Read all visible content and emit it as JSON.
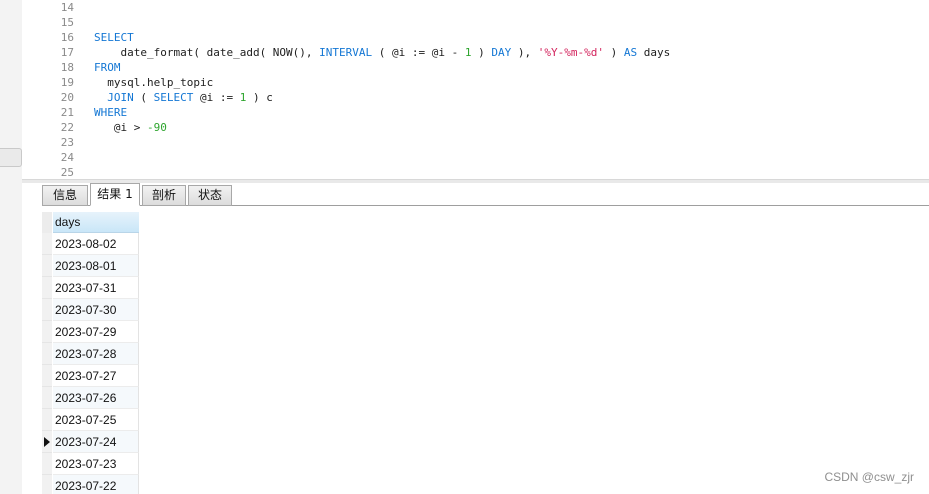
{
  "editor": {
    "lines": [
      {
        "num": "14",
        "tokens": []
      },
      {
        "num": "15",
        "tokens": []
      },
      {
        "num": "16",
        "tokens": [
          {
            "t": "SELECT",
            "c": "kw"
          }
        ]
      },
      {
        "num": "17",
        "tokens": [
          {
            "t": "    date_format( date_add( NOW(), ",
            "c": ""
          },
          {
            "t": "INTERVAL",
            "c": "kw"
          },
          {
            "t": " ( @i := @i - ",
            "c": ""
          },
          {
            "t": "1",
            "c": "num"
          },
          {
            "t": " ) ",
            "c": ""
          },
          {
            "t": "DAY",
            "c": "kw"
          },
          {
            "t": " ), ",
            "c": ""
          },
          {
            "t": "'%Y-%m-%d'",
            "c": "str"
          },
          {
            "t": " ) ",
            "c": ""
          },
          {
            "t": "AS",
            "c": "kw"
          },
          {
            "t": " days",
            "c": ""
          }
        ]
      },
      {
        "num": "18",
        "tokens": [
          {
            "t": "FROM",
            "c": "kw"
          }
        ]
      },
      {
        "num": "19",
        "tokens": [
          {
            "t": "  mysql.help_topic",
            "c": ""
          }
        ]
      },
      {
        "num": "20",
        "tokens": [
          {
            "t": "  ",
            "c": ""
          },
          {
            "t": "JOIN",
            "c": "kw"
          },
          {
            "t": " ( ",
            "c": ""
          },
          {
            "t": "SELECT",
            "c": "kw"
          },
          {
            "t": " @i := ",
            "c": ""
          },
          {
            "t": "1",
            "c": "num"
          },
          {
            "t": " ) c",
            "c": ""
          }
        ]
      },
      {
        "num": "21",
        "tokens": [
          {
            "t": "WHERE",
            "c": "kw"
          }
        ]
      },
      {
        "num": "22",
        "tokens": [
          {
            "t": "   @i > ",
            "c": ""
          },
          {
            "t": "-90",
            "c": "num"
          }
        ]
      },
      {
        "num": "23",
        "tokens": []
      },
      {
        "num": "24",
        "tokens": []
      },
      {
        "num": "25",
        "tokens": []
      }
    ]
  },
  "tabs": [
    {
      "label": "信息",
      "active": false
    },
    {
      "label": "结果 1",
      "active": true
    },
    {
      "label": "剖析",
      "active": false
    },
    {
      "label": "状态",
      "active": false
    }
  ],
  "grid": {
    "column": "days",
    "rows": [
      "2023-08-02",
      "2023-08-01",
      "2023-07-31",
      "2023-07-30",
      "2023-07-29",
      "2023-07-28",
      "2023-07-27",
      "2023-07-26",
      "2023-07-25",
      "2023-07-24",
      "2023-07-23",
      "2023-07-22"
    ],
    "current_row": 9
  },
  "watermark": "CSDN @csw_zjr",
  "colors": {
    "keyword": "#1477d4",
    "number": "#2ea52e",
    "string": "#d3245d",
    "header": "#c9e6f8"
  }
}
